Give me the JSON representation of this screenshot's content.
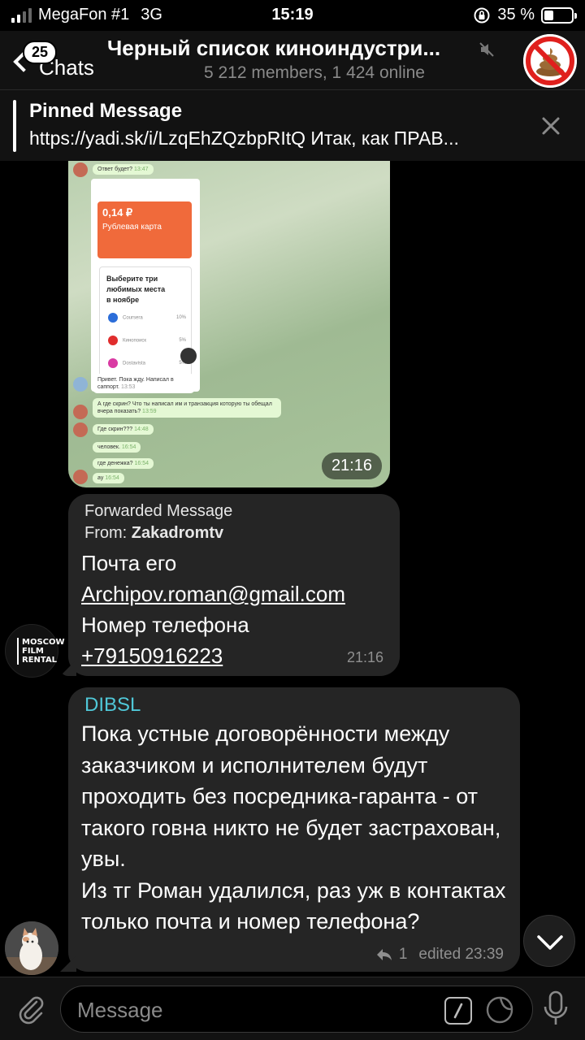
{
  "status_bar": {
    "carrier": "MegaFon #1",
    "network": "3G",
    "time": "15:19",
    "battery_percent": "35 %",
    "battery_level": 0.35
  },
  "header": {
    "back_label": "Chats",
    "unread_count": "25",
    "title": "Черный список киноиндустри...",
    "subtitle": "5 212 members, 1 424 online",
    "muted_icon": "mute-icon",
    "avatar_icon": "no-poop-sign"
  },
  "pinned": {
    "title": "Pinned Message",
    "text": "https://yadi.sk/i/LzqEhZQzbpRItQ Итак, как ПРАВ..."
  },
  "image_message": {
    "time": "21:16",
    "screenshot_texts": {
      "q1": "Ответ будет?",
      "q1_time": "13:47",
      "card_amount": "0,14 ₽",
      "card_name": "Рублевая карта",
      "panel_title": "Выберите три любимых места в ноябре",
      "row1": "Coursera",
      "row1_pct": "10%",
      "row2": "Кинопоиск",
      "row2_pct": "5%",
      "row3": "Dostavista",
      "row3_pct": "5%",
      "reply": "Привет. Пока жду. Написал в саппорт.",
      "reply_time": "13:53",
      "q2": "А где скрин? Что ты написал им и транзакция которую ты обещал вчера показать?",
      "q2_time": "13:59",
      "q3": "Где скрин???",
      "q3_time": "14:48",
      "q4": "человек.",
      "q4_time": "16:54",
      "q5": "где денежка?",
      "q5_time": "16:54",
      "q6": "ау",
      "q6_time": "16:54"
    }
  },
  "forwarded_message": {
    "label": "Forwarded Message",
    "from_prefix": "From: ",
    "from_name": "Zakadromtv",
    "line1": "Почта его",
    "email": "Archipov.roman@gmail.com",
    "line3": "Номер телефона",
    "phone": "+79150916223",
    "time": "21:16",
    "avatar_text": "MOSCOW FILM RENTAL"
  },
  "reply_message": {
    "sender": "DIBSL",
    "text": "Пока устные договорённости между заказчиком и исполнителем будут проходить без посредника-гаранта - от такого говна никто не будет застрахован, увы.",
    "text2": "Из тг Роман удалился, раз уж в контактах только почта и номер телефона?",
    "replies_count": "1",
    "edited_label": "edited 23:39"
  },
  "composer": {
    "placeholder": "Message"
  }
}
